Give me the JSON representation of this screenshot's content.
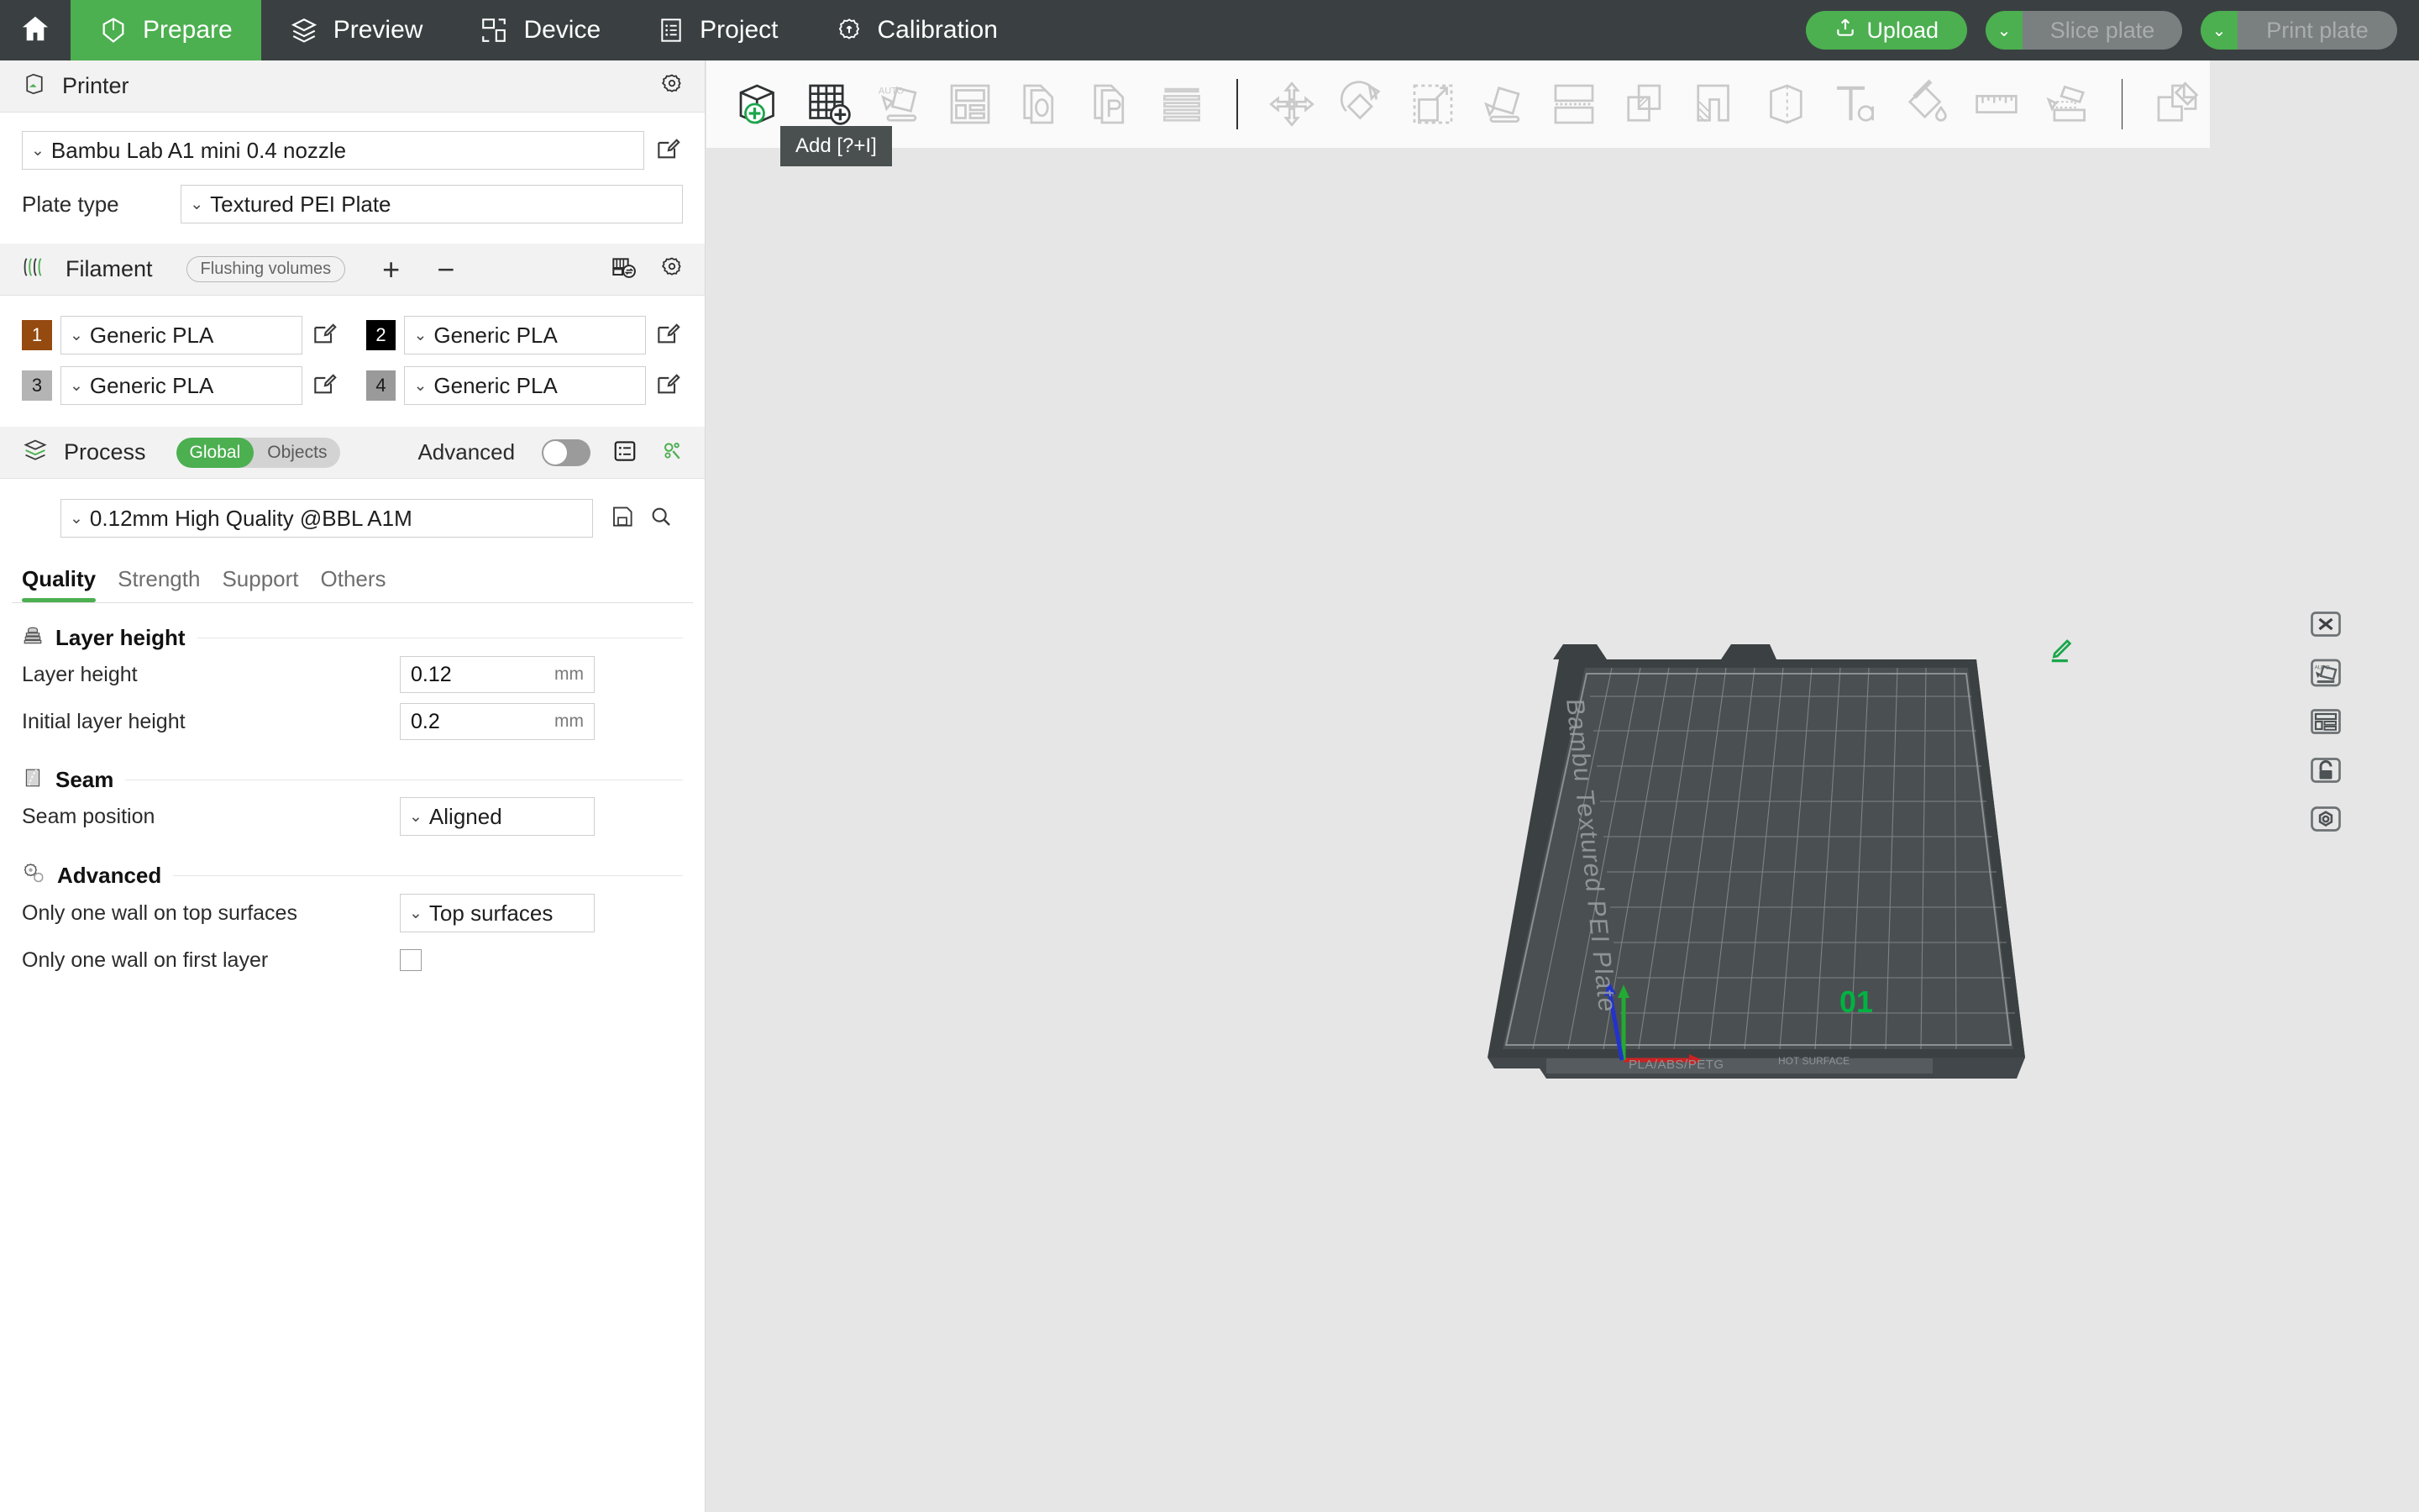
{
  "topbar": {
    "home_icon": "home-icon",
    "tabs": [
      {
        "label": "Prepare",
        "icon": "cube-outline-icon",
        "active": true
      },
      {
        "label": "Preview",
        "icon": "layers-icon",
        "active": false
      },
      {
        "label": "Device",
        "icon": "device-monitor-icon",
        "active": false
      },
      {
        "label": "Project",
        "icon": "list-document-icon",
        "active": false
      },
      {
        "label": "Calibration",
        "icon": "gear-calibration-icon",
        "active": false
      }
    ],
    "upload_label": "Upload",
    "upload_icon": "upload-arrow-icon",
    "slice_plate_label": "Slice plate",
    "print_plate_label": "Print plate",
    "accent_green": "#4caf50",
    "bar_bg": "#3a4042",
    "disabled_btn_bg": "#7a7f80",
    "disabled_btn_text": "#a9adae"
  },
  "sidebar": {
    "printer": {
      "section_title": "Printer",
      "section_icon": "printer-box-icon",
      "settings_icon": "gear-icon",
      "preset_value": "Bambu Lab A1 mini 0.4 nozzle",
      "edit_icon": "edit-pencil-icon",
      "plate_type_label": "Plate type",
      "plate_type_value": "Textured PEI Plate"
    },
    "filament": {
      "section_title": "Filament",
      "section_icon": "filament-spool-icon",
      "flushing_volumes_label": "Flushing volumes",
      "add_icon": "plus-icon",
      "remove_icon": "minus-icon",
      "ams_icon": "ams-sync-icon",
      "settings_icon": "gear-icon",
      "slots": [
        {
          "index": "1",
          "value": "Generic PLA",
          "color": "#954a10"
        },
        {
          "index": "2",
          "value": "Generic PLA",
          "color": "#000000"
        },
        {
          "index": "3",
          "value": "Generic PLA",
          "color": "#b4b4b4"
        },
        {
          "index": "4",
          "value": "Generic PLA",
          "color": "#9a9a9a"
        }
      ]
    },
    "process": {
      "section_title": "Process",
      "section_icon": "process-layers-icon",
      "scope_global": "Global",
      "scope_objects": "Objects",
      "scope_selected": "Global",
      "advanced_label": "Advanced",
      "advanced_on": false,
      "list_icon": "list-view-icon",
      "compare_icon": "search-gears-icon",
      "preset_value": "0.12mm High Quality @BBL A1M",
      "save_icon": "save-floppy-icon",
      "search_icon": "search-icon"
    },
    "tabs": [
      {
        "label": "Quality",
        "selected": true
      },
      {
        "label": "Strength",
        "selected": false
      },
      {
        "label": "Support",
        "selected": false
      },
      {
        "label": "Others",
        "selected": false
      }
    ],
    "groups": [
      {
        "title": "Layer height",
        "icon": "layer-stack-icon",
        "options": [
          {
            "label": "Layer height",
            "type": "number",
            "value": "0.12",
            "unit": "mm"
          },
          {
            "label": "Initial layer height",
            "type": "number",
            "value": "0.2",
            "unit": "mm"
          }
        ]
      },
      {
        "title": "Seam",
        "icon": "seam-icon",
        "options": [
          {
            "label": "Seam position",
            "type": "select",
            "value": "Aligned",
            "unit": ""
          }
        ]
      },
      {
        "title": "Advanced",
        "icon": "gears-icon",
        "options": [
          {
            "label": "Only one wall on top surfaces",
            "type": "select",
            "value": "Top surfaces",
            "unit": ""
          },
          {
            "label": "Only one wall on first layer",
            "type": "checkbox",
            "value": "",
            "checked": false,
            "unit": ""
          }
        ]
      }
    ]
  },
  "viewport": {
    "toolbar": [
      {
        "name": "add-object-icon",
        "enabled": true
      },
      {
        "name": "add-plate-icon",
        "enabled": true
      },
      {
        "name": "auto-arrange-icon",
        "enabled": false
      },
      {
        "name": "arrange-layout-icon",
        "enabled": false
      },
      {
        "name": "copy-object-icon",
        "enabled": false
      },
      {
        "name": "paste-object-icon",
        "enabled": false
      },
      {
        "name": "layers-list-icon",
        "enabled": false
      },
      {
        "name": "separator",
        "enabled": false
      },
      {
        "name": "move-icon",
        "enabled": false
      },
      {
        "name": "rotate-icon",
        "enabled": false
      },
      {
        "name": "scale-icon",
        "enabled": false
      },
      {
        "name": "place-on-face-icon",
        "enabled": false
      },
      {
        "name": "cut-icon",
        "enabled": false
      },
      {
        "name": "mesh-boolean-icon",
        "enabled": false
      },
      {
        "name": "support-painting-icon",
        "enabled": false
      },
      {
        "name": "seam-painting-icon",
        "enabled": false
      },
      {
        "name": "text-emboss-icon",
        "enabled": false
      },
      {
        "name": "color-painting-icon",
        "enabled": false
      },
      {
        "name": "measure-icon",
        "enabled": false
      },
      {
        "name": "assembly-icon",
        "enabled": false
      },
      {
        "name": "separator",
        "enabled": false
      },
      {
        "name": "assemble-view-icon",
        "enabled": false
      }
    ],
    "tooltip": "Add [?+I]",
    "plate": {
      "brand_text": "Bambu Textured PEI Plate",
      "label": "01",
      "label_color": "#00b341",
      "edit_icon": "edit-plate-name-icon",
      "footer_materials": "PLA/ABS/PETG",
      "footer_warning": "HOT SURFACE",
      "surface_color": "#4a4f51",
      "frame_color": "#3b4042",
      "side_buttons": [
        {
          "name": "delete-plate-icon"
        },
        {
          "name": "auto-arrange-plate-icon"
        },
        {
          "name": "plate-settings-layout-icon"
        },
        {
          "name": "lock-plate-icon"
        },
        {
          "name": "plate-settings-icon"
        }
      ],
      "axis": {
        "x_color": "#cc2222",
        "y_color": "#22aa33",
        "z_color": "#2233cc"
      }
    }
  }
}
